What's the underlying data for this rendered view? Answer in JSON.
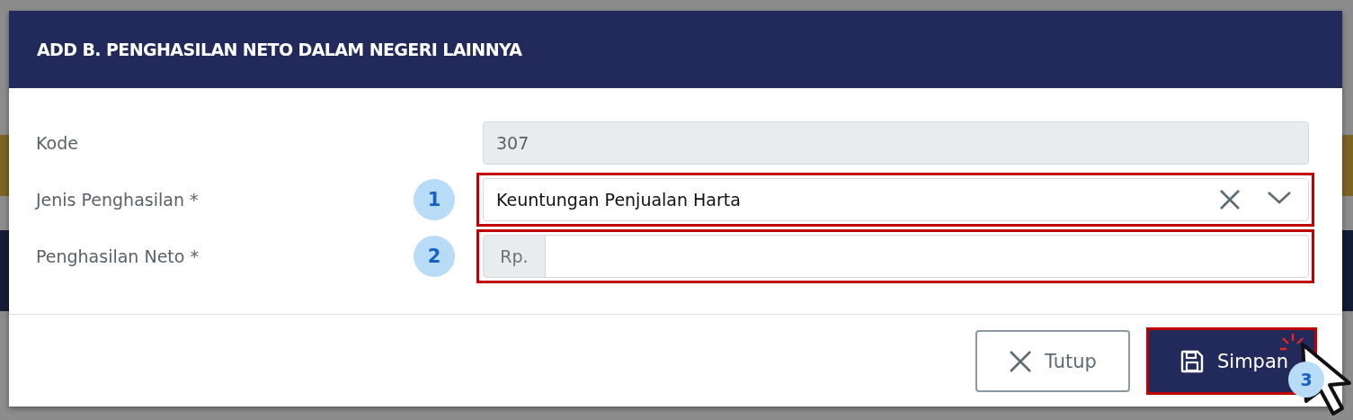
{
  "dialog": {
    "title": "ADD B. PENGHASILAN NETO DALAM NEGERI LAINNYA",
    "fields": [
      {
        "kind": "readonly",
        "label": "Kode",
        "value": "307",
        "highlighted": false
      },
      {
        "kind": "select",
        "label": "Jenis Penghasilan *",
        "value": "Keuntungan Penjualan Harta",
        "marker": "1",
        "highlighted": true
      },
      {
        "kind": "currency",
        "label": "Penghasilan Neto *",
        "prefix": "Rp.",
        "marker": "2",
        "highlighted": true
      }
    ],
    "buttons": [
      {
        "kind": "close",
        "label": "Tutup",
        "highlighted": false
      },
      {
        "kind": "save",
        "label": "Simpan",
        "highlighted": true,
        "marker": "3"
      }
    ]
  }
}
